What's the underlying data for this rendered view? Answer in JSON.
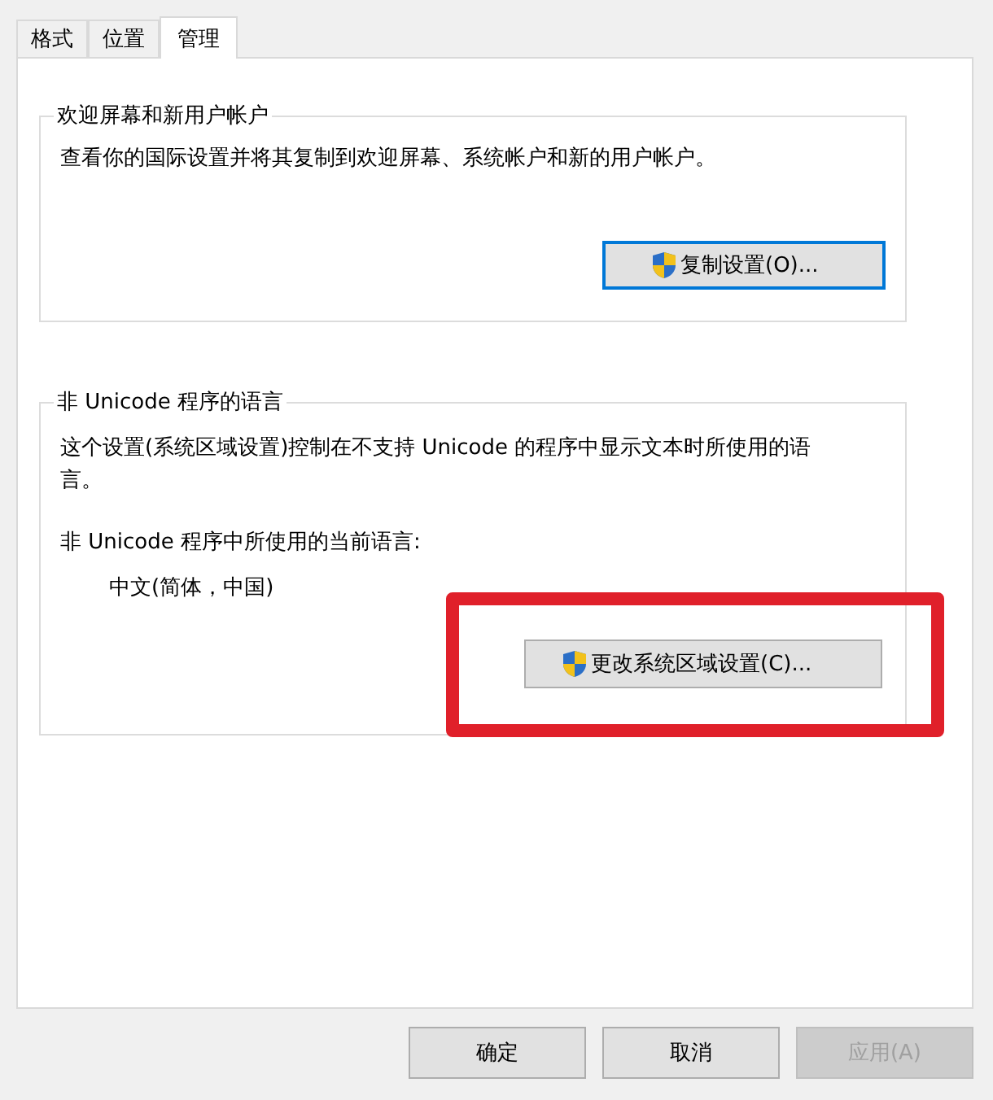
{
  "tabs": [
    {
      "label": "格式",
      "selected": false
    },
    {
      "label": "位置",
      "selected": false
    },
    {
      "label": "管理",
      "selected": true
    }
  ],
  "welcome_group": {
    "title": "欢迎屏幕和新用户帐户",
    "description": "查看你的国际设置并将其复制到欢迎屏幕、系统帐户和新的用户帐户。",
    "button": {
      "label": "复制设置(O)...",
      "focused": true
    }
  },
  "non_unicode_group": {
    "title": "非 Unicode 程序的语言",
    "description": "这个设置(系统区域设置)控制在不支持 Unicode 的程序中显示文本时所使用的语言。",
    "current_label": "非 Unicode 程序中所使用的当前语言:",
    "current_value": "中文(简体，中国)",
    "button": {
      "label": "更改系统区域设置(C)...",
      "focused": false
    },
    "highlighted": true
  },
  "buttons": [
    {
      "label": "确定",
      "disabled": false
    },
    {
      "label": "取消",
      "disabled": false
    },
    {
      "label": "应用(A)",
      "disabled": true
    }
  ]
}
